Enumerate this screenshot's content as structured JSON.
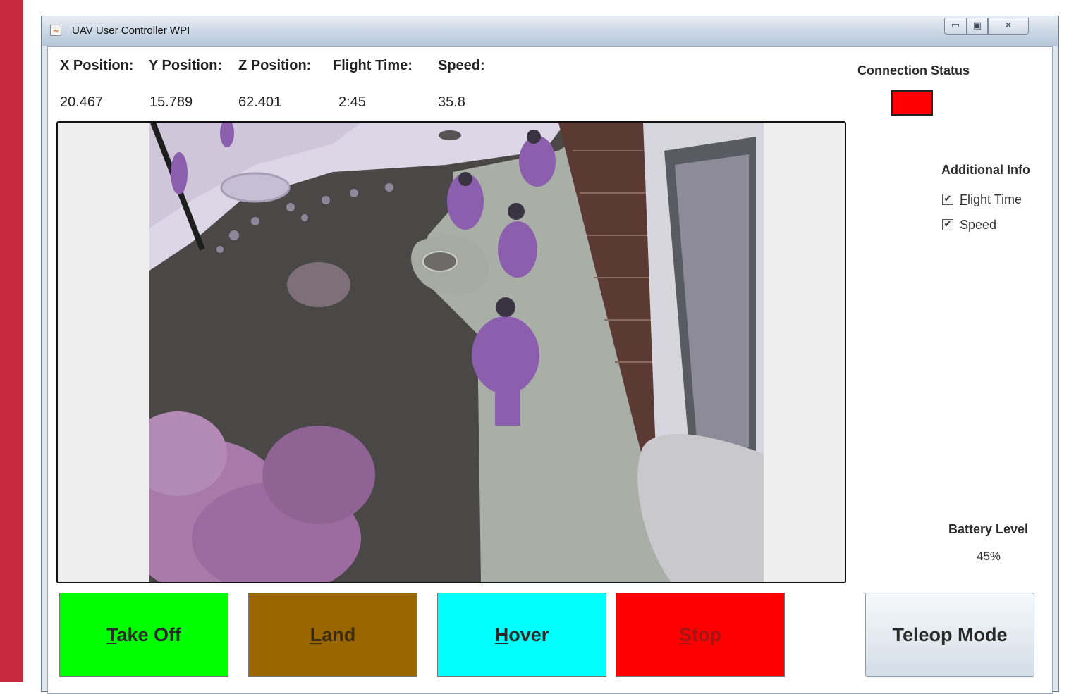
{
  "window": {
    "title": "UAV User Controller WPI",
    "controls": {
      "minimize": "▭",
      "maximize": "▣",
      "close": "✕"
    }
  },
  "telemetry": {
    "headers": [
      "X Position:",
      "Y Position:",
      "Z Position:",
      "Flight Time:",
      "Speed:"
    ],
    "values": [
      "20.467",
      "15.789",
      "62.401",
      "2:45",
      "35.8"
    ]
  },
  "connection": {
    "label": "Connection Status",
    "status_color": "#ff0000"
  },
  "additional_info": {
    "label": "Additional Info",
    "options": [
      {
        "mnemonic": "F",
        "rest": "light Time",
        "checked": true
      },
      {
        "pre": "S",
        "mnemonic": "p",
        "rest": "eed",
        "checked": true
      }
    ]
  },
  "battery": {
    "label": "Battery Level",
    "value": "45%"
  },
  "controls": {
    "takeoff": {
      "mnemonic": "T",
      "rest": "ake Off",
      "color": "#00ff00"
    },
    "land": {
      "mnemonic": "L",
      "rest": "and",
      "color": "#996600"
    },
    "hover": {
      "mnemonic": "H",
      "rest": "over",
      "color": "#00ffff"
    },
    "stop": {
      "mnemonic": "S",
      "rest": "top",
      "color": "#ff0000"
    },
    "teleop": {
      "label": "Teleop Mode"
    }
  },
  "icons": {
    "app": "java-cup-icon",
    "check": "✔"
  }
}
